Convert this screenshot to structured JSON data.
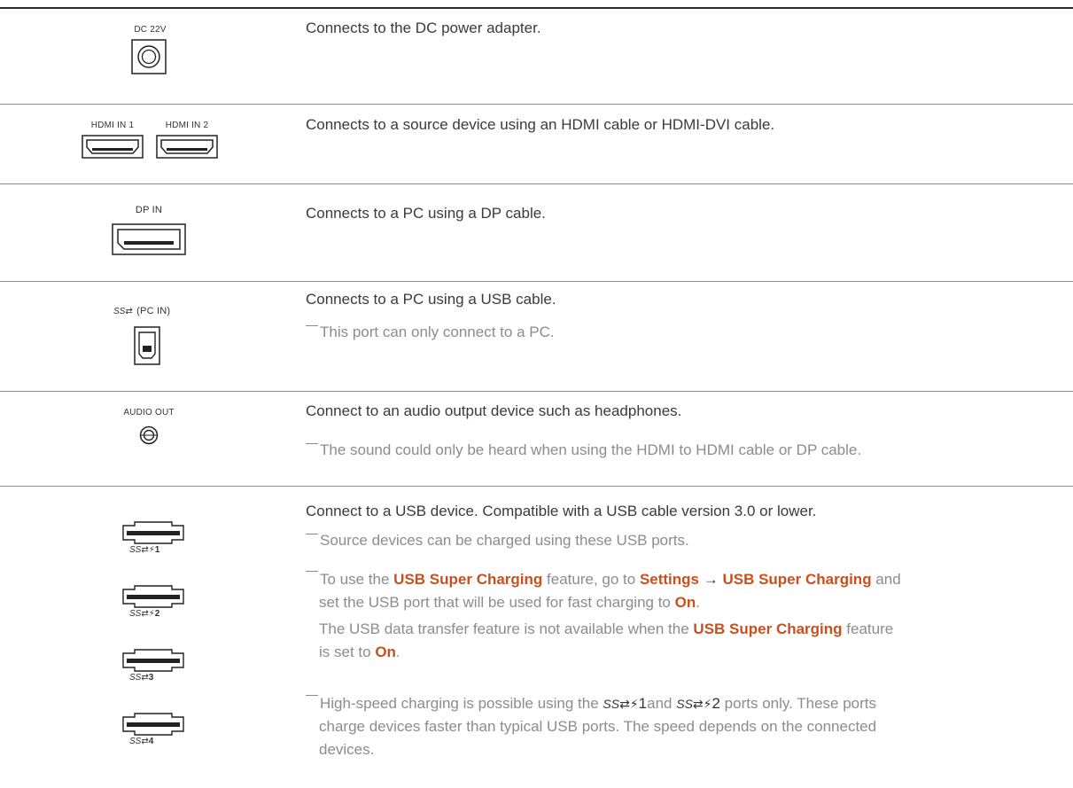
{
  "rows": {
    "dc": {
      "label": "DC 22V",
      "description": "Connects to the DC power adapter."
    },
    "hdmi": {
      "label1": "HDMI IN 1",
      "label2": "HDMI IN 2",
      "description": "Connects to a source device using an HDMI cable or HDMI-DVI cable."
    },
    "dp": {
      "label": "DP IN",
      "description": "Connects to a PC using a DP cable."
    },
    "usb_pc": {
      "label": "(PC IN)",
      "description": "Connects to a PC using a USB cable.",
      "note": "This port can only connect to a PC."
    },
    "audio": {
      "label": "AUDIO OUT",
      "description": "Connect to an audio output device such as headphones.",
      "note": "The sound could only be heard when using the HDMI to HDMI cable or DP cable."
    },
    "usb_dev": {
      "ports": [
        "1",
        "2",
        "3",
        "4"
      ],
      "description": "Connect to a USB device. Compatible with a USB cable version 3.0 or lower.",
      "note1": "Source devices can be charged using these USB ports.",
      "note2": {
        "p1": "To use the ",
        "hl1": "USB Super Charging",
        "p2": " feature, go to ",
        "hl2": "Settings",
        "arrow": " → ",
        "hl3": "USB Super Charging",
        "p3": " and",
        "line2": "set the USB port that will be used for fast charging to ",
        "hl4": "On",
        "end1": ".",
        "line3a": "The USB data transfer feature is not available when the ",
        "hl5": "USB Super Charging",
        "line3b": " feature",
        "line4a": "is set to ",
        "hl6": "On",
        "end2": "."
      },
      "note3": {
        "p1": "High-speed charging is possible using the ",
        "port1": "1",
        "p2": "and ",
        "port2": "2",
        "p3": " ports only. These ports",
        "line2": "charge devices faster than typical USB ports. The speed depends on the connected",
        "line3": "devices."
      }
    }
  },
  "colors": {
    "highlight": "#c8501e",
    "note": "#8c8c8c",
    "text": "#3a3a3a"
  },
  "icons": [
    "dc-jack-icon",
    "hdmi-port-icon",
    "displayport-icon",
    "usb-b-port-icon",
    "usb-superspeed-icon",
    "audio-jack-icon",
    "usb-a-port-icon",
    "charging-icon"
  ]
}
